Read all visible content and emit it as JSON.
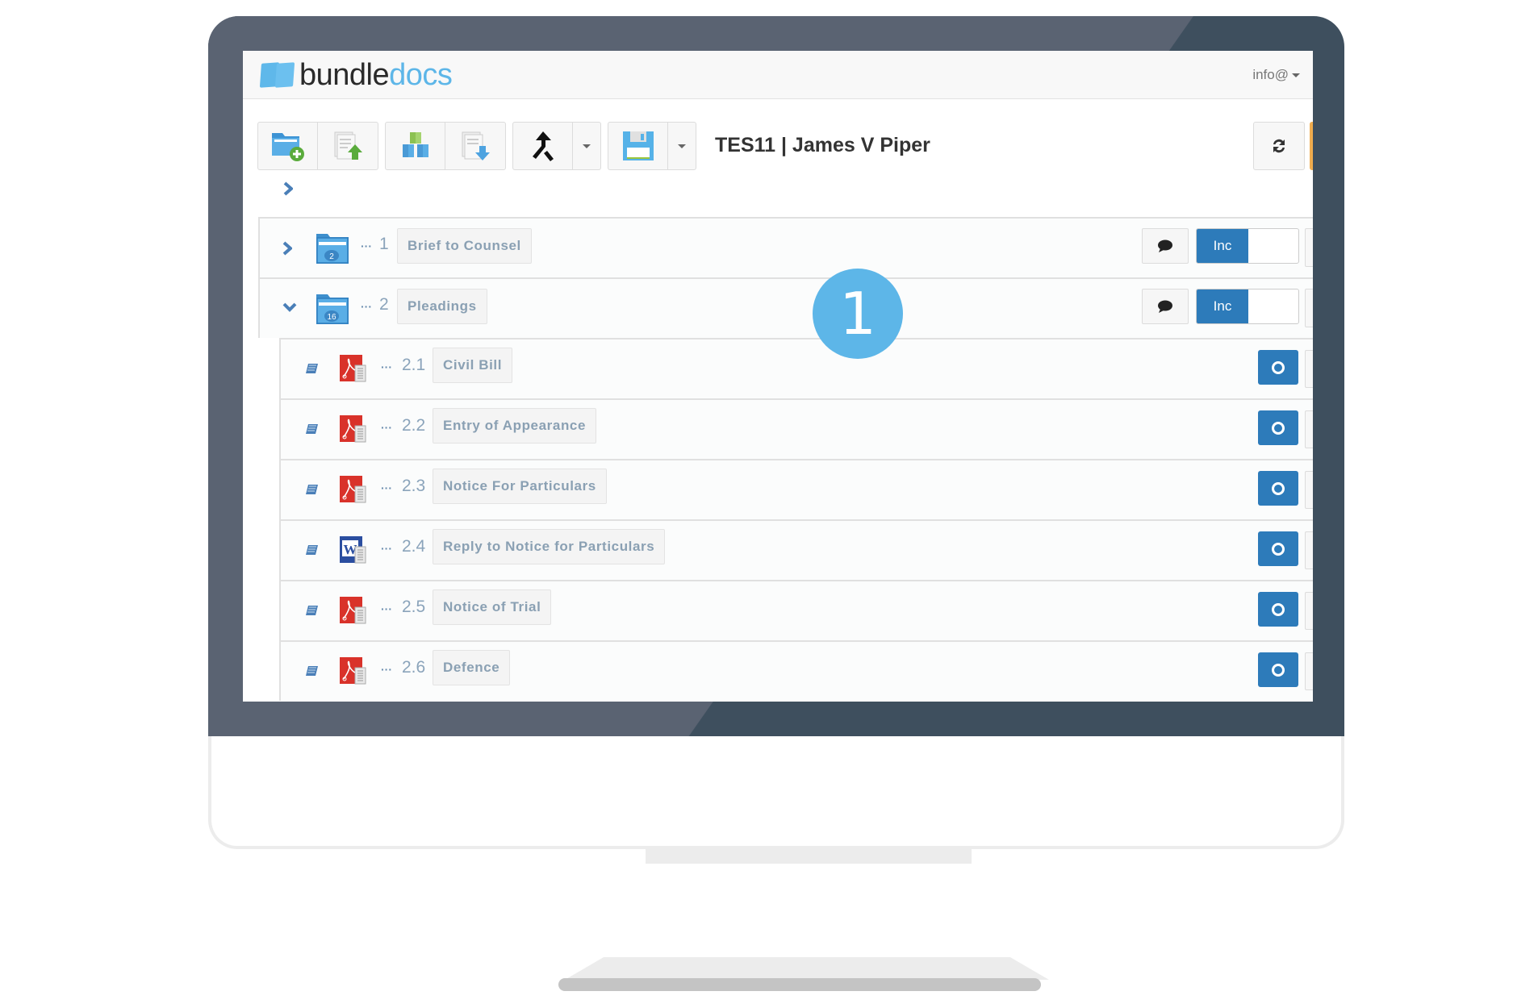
{
  "app": {
    "logo_part1": "bundle",
    "logo_part2": "docs",
    "user_menu": "info@"
  },
  "colors": {
    "accent_blue": "#2d7bba",
    "logo_blue": "#5db6e8",
    "help_orange": "#efac4e",
    "bezel": "#3e4f5e"
  },
  "toolbar": {
    "buttons": [
      {
        "name": "add-folder",
        "icon": "folder-plus-icon"
      },
      {
        "name": "upload-document",
        "icon": "document-upload-icon"
      },
      {
        "name": "build-bundle",
        "icon": "cubes-icon"
      },
      {
        "name": "download-document",
        "icon": "document-download-icon"
      },
      {
        "name": "merge",
        "icon": "merge-icon"
      },
      {
        "name": "merge-dropdown",
        "icon": "caret-down-icon"
      },
      {
        "name": "save",
        "icon": "floppy-disk-icon"
      },
      {
        "name": "save-dropdown",
        "icon": "caret-down-icon"
      }
    ],
    "refresh_icon": "refresh-icon",
    "help_glyph": "?"
  },
  "document_title": "TES11 | James V Piper",
  "step_badge": "1",
  "sections": [
    {
      "number": "1",
      "title": "Brief to Counsel",
      "count": "2",
      "expanded": false,
      "toggle_label": "Inc"
    },
    {
      "number": "2",
      "title": "Pleadings",
      "count": "16",
      "expanded": true,
      "toggle_label": "Inc"
    }
  ],
  "documents": [
    {
      "number": "2.1",
      "title": "Civil Bill",
      "type": "pdf"
    },
    {
      "number": "2.2",
      "title": "Entry of Appearance",
      "type": "pdf"
    },
    {
      "number": "2.3",
      "title": "Notice For Particulars",
      "type": "pdf"
    },
    {
      "number": "2.4",
      "title": "Reply to Notice for Particulars",
      "type": "word"
    },
    {
      "number": "2.5",
      "title": "Notice of Trial",
      "type": "pdf"
    },
    {
      "number": "2.6",
      "title": "Defence",
      "type": "pdf"
    }
  ],
  "dots_glyph": "···"
}
